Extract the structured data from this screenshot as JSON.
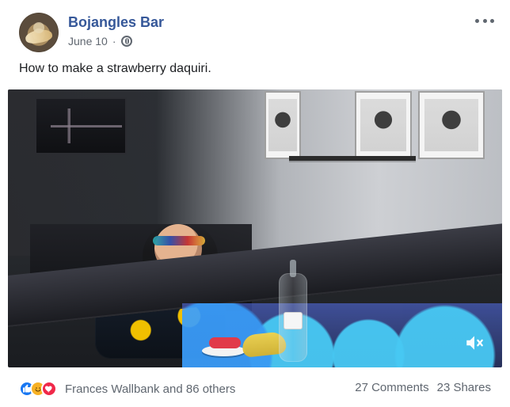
{
  "post": {
    "page_name": "Bojangles Bar",
    "date": "June 10",
    "separator": "·",
    "text": "How to make a strawberry daquiri."
  },
  "footer": {
    "reaction_summary": "Frances Wallbank and 86 others",
    "comments": "27 Comments",
    "shares": "23 Shares"
  },
  "icons": {
    "more": "more-options-icon",
    "privacy": "globe-icon",
    "mute": "mute-icon",
    "reactions": [
      "like-reaction-icon",
      "haha-reaction-icon",
      "love-reaction-icon"
    ]
  },
  "colors": {
    "facebook_blue": "#1877f2",
    "page_name_blue": "#365899",
    "muted_text": "#606770"
  }
}
